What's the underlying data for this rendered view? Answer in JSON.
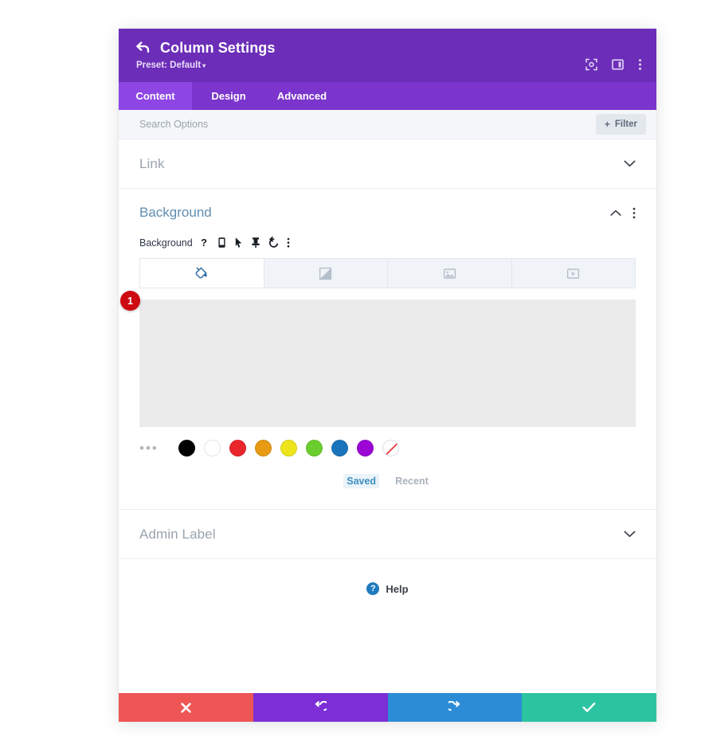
{
  "header": {
    "back_icon": "back-arrow-icon",
    "title": "Column Settings",
    "preset_label": "Preset: Default",
    "preset_caret": "▾",
    "tools": [
      {
        "name": "fullscreen-icon"
      },
      {
        "name": "layout-panel-icon"
      },
      {
        "name": "more-options-icon"
      }
    ]
  },
  "tabs": [
    {
      "label": "Content",
      "active": true
    },
    {
      "label": "Design",
      "active": false
    },
    {
      "label": "Advanced",
      "active": false
    }
  ],
  "search": {
    "placeholder": "Search Options",
    "value": "",
    "filter_label": "Filter",
    "filter_plus": "+"
  },
  "sections": {
    "link": {
      "label": "Link",
      "expanded": false,
      "chevron": "chevron-down-icon"
    },
    "background": {
      "label": "Background",
      "expanded": true,
      "chevron": "chevron-up-icon",
      "menu_icon": "more-options-icon",
      "field_label": "Background",
      "field_icons": [
        "help-icon",
        "device-mobile-icon",
        "cursor-icon",
        "pin-icon",
        "reset-icon",
        "more-options-icon"
      ],
      "type_tabs": [
        {
          "name": "background-color-tab",
          "icon": "paint-bucket-icon",
          "active": true
        },
        {
          "name": "background-gradient-tab",
          "icon": "gradient-icon",
          "active": false
        },
        {
          "name": "background-image-tab",
          "icon": "image-icon",
          "active": false
        },
        {
          "name": "background-video-tab",
          "icon": "video-icon",
          "active": false
        }
      ],
      "preview_color": "#EBEBEB",
      "badge_number": "1",
      "badge_color": "#CE0A12",
      "swatch_more": "•••",
      "swatches": [
        {
          "name": "swatch-black",
          "color": "#000000"
        },
        {
          "name": "swatch-white",
          "color": "#FFFFFF"
        },
        {
          "name": "swatch-red",
          "color": "#E8262B"
        },
        {
          "name": "swatch-orange",
          "color": "#E79A12"
        },
        {
          "name": "swatch-yellow",
          "color": "#EDE41B"
        },
        {
          "name": "swatch-green",
          "color": "#6BCE2E"
        },
        {
          "name": "swatch-blue",
          "color": "#1A74BC"
        },
        {
          "name": "swatch-purple",
          "color": "#9B06D4"
        },
        {
          "name": "swatch-transparent",
          "color": "transparent"
        }
      ],
      "palette_tabs": [
        {
          "label": "Saved",
          "active": true
        },
        {
          "label": "Recent",
          "active": false
        }
      ]
    },
    "admin_label": {
      "label": "Admin Label",
      "expanded": false,
      "chevron": "chevron-down-icon"
    }
  },
  "help": {
    "icon": "question-mark-icon",
    "label": "Help"
  },
  "footer": [
    {
      "name": "cancel-button",
      "icon": "close-icon",
      "color": "#EE5555"
    },
    {
      "name": "undo-button",
      "icon": "undo-icon",
      "color": "#7B2FD4"
    },
    {
      "name": "redo-button",
      "icon": "redo-icon",
      "color": "#2C8CD6"
    },
    {
      "name": "save-button",
      "icon": "checkmark-icon",
      "color": "#2CC4A0"
    }
  ]
}
